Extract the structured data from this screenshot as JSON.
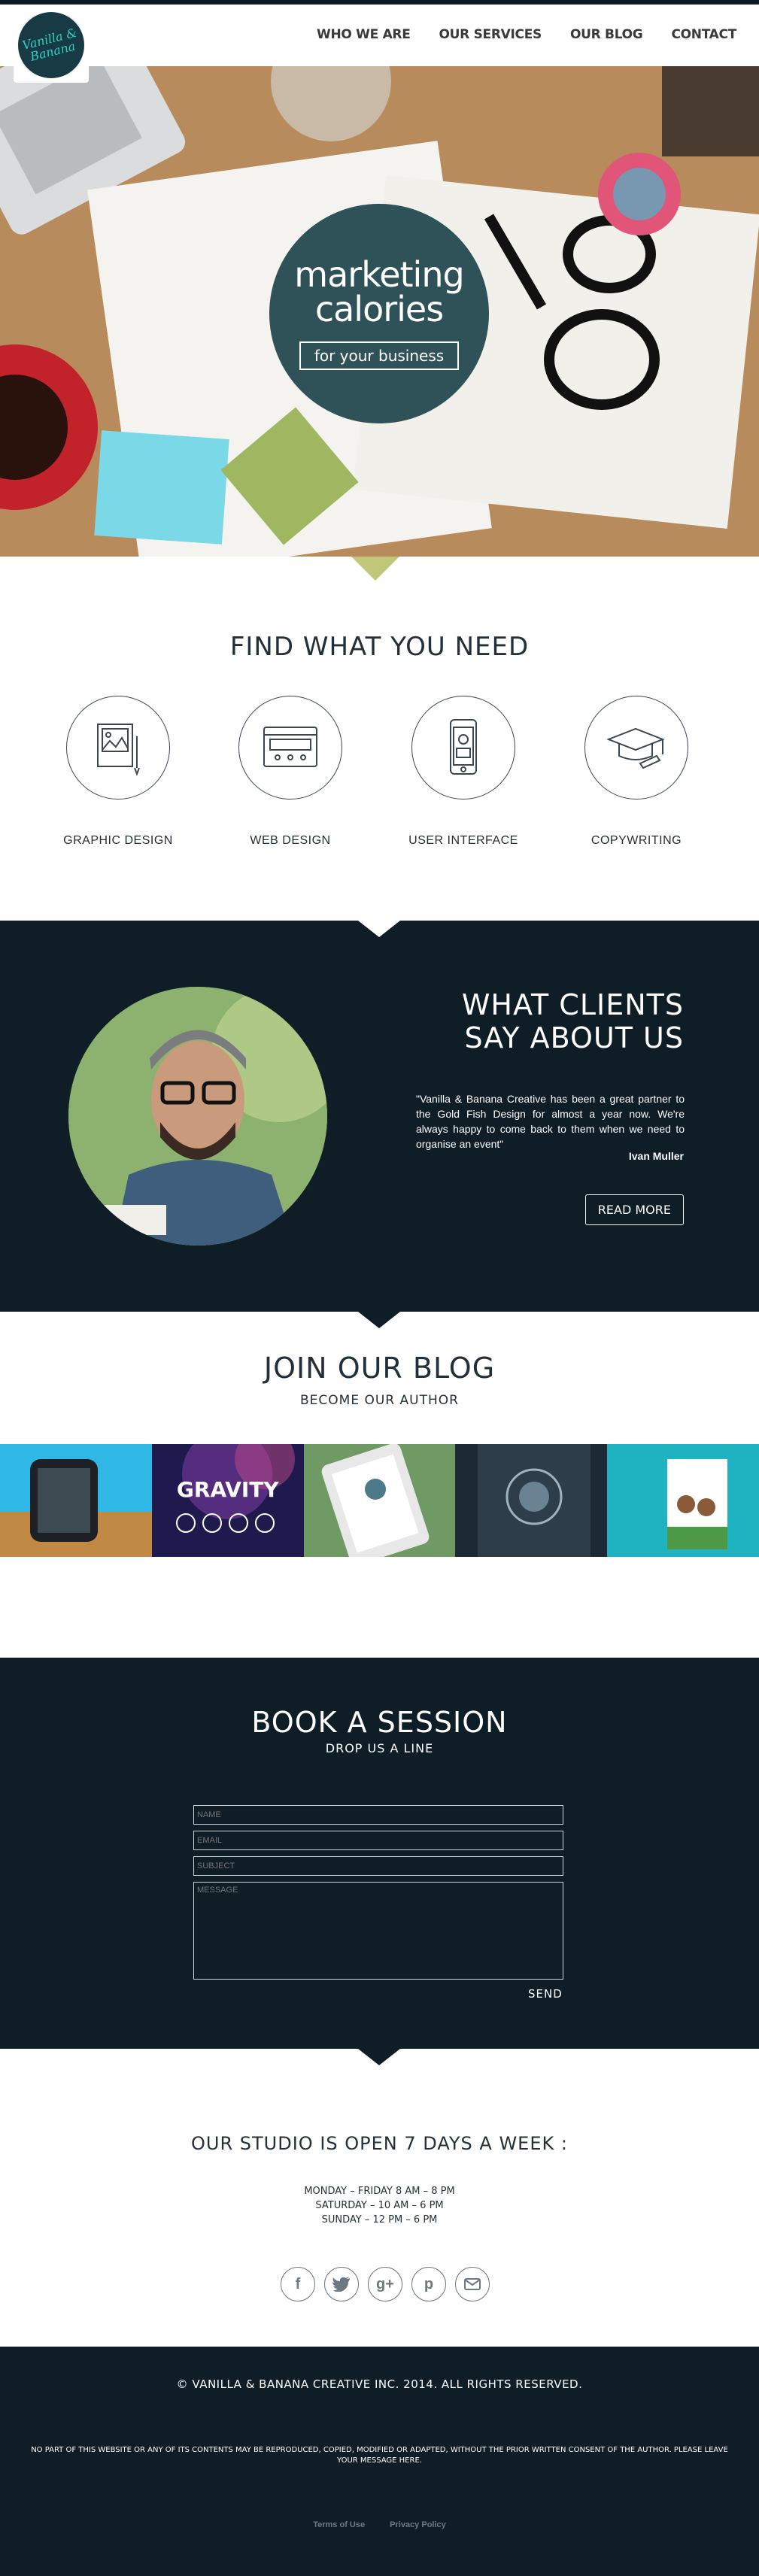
{
  "brand": {
    "logo_text": "Vanilla & Banana"
  },
  "nav": {
    "items": [
      "WHO WE ARE",
      "OUR SERVICES",
      "OUR BLOG",
      "CONTACT"
    ]
  },
  "hero": {
    "title_line1": "marketing",
    "title_line2": "calories",
    "subtitle": "for your business"
  },
  "find": {
    "title": "FIND WHAT YOU NEED",
    "services": [
      "GRAPHIC DESIGN",
      "WEB DESIGN",
      "USER INTERFACE",
      "COPYWRITING"
    ]
  },
  "clients": {
    "title_line1": "WHAT CLIENTS",
    "title_line2": "SAY ABOUT US",
    "quote": "\"Vanilla & Banana Creative has been a great partner to the Gold Fish Design for almost a year now. We're always happy to come back to them when we need to organise an event\"",
    "author": "Ivan Muller",
    "button": "READ MORE"
  },
  "blog": {
    "title": "JOIN OUR BLOG",
    "subtitle": "BECOME OUR AUTHOR",
    "gallery_tile_text": "GRAVITY"
  },
  "book": {
    "title": "BOOK A SESSION",
    "subtitle": "DROP US A LINE",
    "placeholders": {
      "name": "NAME",
      "email": "EMAIL",
      "subject": "SUBJECT",
      "message": "MESSAGE"
    },
    "send": "SEND"
  },
  "studio": {
    "title": "OUR STUDIO IS OPEN 7 DAYS A WEEK :",
    "hours": [
      "MONDAY – FRIDAY 8 AM – 8 PM",
      "SATURDAY – 10 AM – 6 PM",
      "SUNDAY – 12 PM – 6 PM"
    ],
    "social": [
      "facebook-icon",
      "twitter-icon",
      "google-plus-icon",
      "pinterest-icon",
      "email-icon"
    ]
  },
  "footer": {
    "copyright": "© VANILLA & BANANA CREATIVE INC. 2014.  ALL RIGHTS RESERVED.",
    "legal": "NO PART OF THIS WEBSITE OR ANY OF ITS CONTENTS MAY BE REPRODUCED, COPIED, MODIFIED OR ADAPTED, WITHOUT THE PRIOR WRITTEN CONSENT OF THE AUTHOR. PLEASE LEAVE YOUR MESSAGE HERE.",
    "links": [
      "Terms of Use",
      "Privacy Policy"
    ]
  },
  "colors": {
    "dark": "#0e1d26",
    "accent": "#2f5158",
    "teal": "#32d0c0"
  }
}
